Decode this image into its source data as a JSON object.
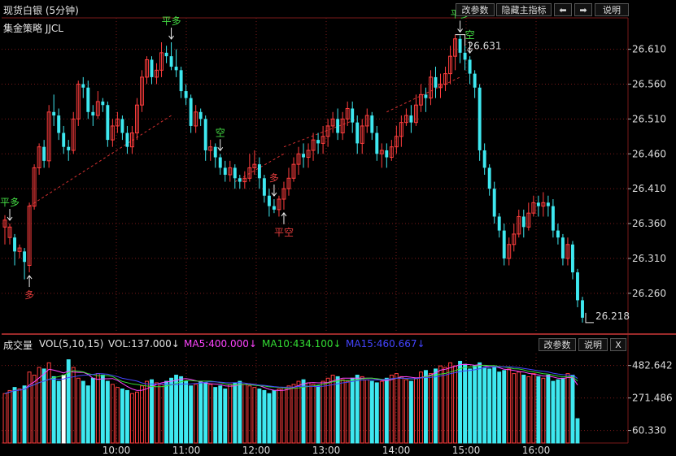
{
  "window": {
    "title": "现货白银 (5分钟)",
    "strategy": "集金策略 JJCL"
  },
  "toolbar": {
    "params_label": "改参数",
    "hide_indicator_label": "隐藏主指标",
    "left_arrow": "⬅",
    "right_arrow": "➡",
    "help_label": "说明"
  },
  "volume_panel": {
    "title": "成交量",
    "vol_params": "VOL(5,10,15)",
    "vol_value": "VOL:137.000↓",
    "ma5": "MA5:400.000↓",
    "ma10": "MA10:434.100↓",
    "ma15": "MA15:460.667↓",
    "params_label": "改参数",
    "help_label": "说明",
    "close_label": "X"
  },
  "colors": {
    "up": "#ff3d3d",
    "down": "#3ee8f0",
    "ma5": "#ff44ff",
    "ma10": "#33dd33",
    "ma15": "#4444ff",
    "grid": "#7a1a1a",
    "buy": "#e23c3c",
    "sell": "#44dd44"
  },
  "chart_data": [
    {
      "type": "candlestick",
      "title": "现货白银 (5分钟)",
      "y_ticks": [
        "26.610",
        "26.560",
        "26.510",
        "26.460",
        "26.410",
        "26.360",
        "26.310",
        "26.260"
      ],
      "ylim": [
        26.205,
        26.655
      ],
      "x_ticks": [
        "10:00",
        "11:00",
        "12:00",
        "13:00",
        "14:00",
        "15:00",
        "16:00"
      ],
      "price_labels": {
        "high": "26.631",
        "low": "26.218"
      },
      "ohlc": [
        [
          26.355,
          26.365,
          26.33,
          26.372
        ],
        [
          26.34,
          26.355,
          26.33,
          26.36
        ],
        [
          26.34,
          26.32,
          26.3,
          26.345
        ],
        [
          26.32,
          26.325,
          26.31,
          26.33
        ],
        [
          26.32,
          26.305,
          26.28,
          26.325
        ],
        [
          26.3,
          26.385,
          26.29,
          26.39
        ],
        [
          26.385,
          26.44,
          26.38,
          26.445
        ],
        [
          26.44,
          26.47,
          26.43,
          26.475
        ],
        [
          26.47,
          26.45,
          26.44,
          26.48
        ],
        [
          26.45,
          26.52,
          26.44,
          26.53
        ],
        [
          26.52,
          26.515,
          26.5,
          26.545
        ],
        [
          26.515,
          26.49,
          26.48,
          26.525
        ],
        [
          26.49,
          26.47,
          26.46,
          26.5
        ],
        [
          26.47,
          26.465,
          26.45,
          26.48
        ],
        [
          26.465,
          26.51,
          26.46,
          26.52
        ],
        [
          26.51,
          26.56,
          26.5,
          26.565
        ],
        [
          26.56,
          26.555,
          26.54,
          26.57
        ],
        [
          26.555,
          26.52,
          26.51,
          26.565
        ],
        [
          26.52,
          26.515,
          26.5,
          26.53
        ],
        [
          26.515,
          26.535,
          26.51,
          26.55
        ],
        [
          26.535,
          26.53,
          26.52,
          26.54
        ],
        [
          26.53,
          26.48,
          26.47,
          26.535
        ],
        [
          26.48,
          26.5,
          26.47,
          26.51
        ],
        [
          26.5,
          26.51,
          26.49,
          26.52
        ],
        [
          26.51,
          26.49,
          26.48,
          26.515
        ],
        [
          26.49,
          26.47,
          26.46,
          26.5
        ],
        [
          26.47,
          26.49,
          26.46,
          26.5
        ],
        [
          26.49,
          26.53,
          26.48,
          26.54
        ],
        [
          26.53,
          26.57,
          26.52,
          26.58
        ],
        [
          26.57,
          26.595,
          26.56,
          26.6
        ],
        [
          26.595,
          26.57,
          26.56,
          26.6
        ],
        [
          26.57,
          26.58,
          26.56,
          26.59
        ],
        [
          26.58,
          26.605,
          26.57,
          26.62
        ],
        [
          26.605,
          26.6,
          26.59,
          26.615
        ],
        [
          26.6,
          26.585,
          26.58,
          26.62
        ],
        [
          26.585,
          26.58,
          26.57,
          26.61
        ],
        [
          26.58,
          26.55,
          26.54,
          26.585
        ],
        [
          26.55,
          26.54,
          26.53,
          26.56
        ],
        [
          26.54,
          26.5,
          26.49,
          26.545
        ],
        [
          26.5,
          26.52,
          26.49,
          26.53
        ],
        [
          26.52,
          26.51,
          26.5,
          26.525
        ],
        [
          26.51,
          26.465,
          26.45,
          26.515
        ],
        [
          26.465,
          26.47,
          26.45,
          26.48
        ],
        [
          26.47,
          26.455,
          26.44,
          26.475
        ],
        [
          26.455,
          26.44,
          26.43,
          26.46
        ],
        [
          26.44,
          26.43,
          26.42,
          26.45
        ],
        [
          26.43,
          26.44,
          26.42,
          26.45
        ],
        [
          26.44,
          26.425,
          26.41,
          26.445
        ],
        [
          26.425,
          26.42,
          26.41,
          26.43
        ],
        [
          26.42,
          26.425,
          26.41,
          26.435
        ],
        [
          26.425,
          26.44,
          26.42,
          26.46
        ],
        [
          26.44,
          26.445,
          26.43,
          26.465
        ],
        [
          26.445,
          26.425,
          26.41,
          26.455
        ],
        [
          26.425,
          26.4,
          26.39,
          26.43
        ],
        [
          26.4,
          26.385,
          26.37,
          26.41
        ],
        [
          26.385,
          26.38,
          26.375,
          26.395
        ],
        [
          26.38,
          26.395,
          26.37,
          26.4
        ],
        [
          26.395,
          26.41,
          26.38,
          26.42
        ],
        [
          26.41,
          26.425,
          26.4,
          26.44
        ],
        [
          26.425,
          26.445,
          26.42,
          26.455
        ],
        [
          26.445,
          26.46,
          26.43,
          26.47
        ],
        [
          26.46,
          26.455,
          26.44,
          26.475
        ],
        [
          26.455,
          26.465,
          26.44,
          26.475
        ],
        [
          26.465,
          26.48,
          26.45,
          26.49
        ],
        [
          26.48,
          26.475,
          26.46,
          26.49
        ],
        [
          26.475,
          26.485,
          26.46,
          26.5
        ],
        [
          26.485,
          26.5,
          26.47,
          26.51
        ],
        [
          26.5,
          26.51,
          26.49,
          26.52
        ],
        [
          26.51,
          26.49,
          26.48,
          26.525
        ],
        [
          26.49,
          26.51,
          26.48,
          26.52
        ],
        [
          26.51,
          26.525,
          26.5,
          26.535
        ],
        [
          26.525,
          26.505,
          26.49,
          26.535
        ],
        [
          26.505,
          26.475,
          26.46,
          26.515
        ],
        [
          26.475,
          26.5,
          26.46,
          26.51
        ],
        [
          26.5,
          26.515,
          26.49,
          26.525
        ],
        [
          26.515,
          26.49,
          26.48,
          26.52
        ],
        [
          26.49,
          26.46,
          26.45,
          26.5
        ],
        [
          26.46,
          26.465,
          26.44,
          26.475
        ],
        [
          26.465,
          26.455,
          26.44,
          26.475
        ],
        [
          26.455,
          26.47,
          26.45,
          26.48
        ],
        [
          26.47,
          26.485,
          26.46,
          26.5
        ],
        [
          26.485,
          26.505,
          26.47,
          26.515
        ],
        [
          26.505,
          26.515,
          26.5,
          26.525
        ],
        [
          26.515,
          26.505,
          26.49,
          26.53
        ],
        [
          26.505,
          26.53,
          26.5,
          26.545
        ],
        [
          26.53,
          26.545,
          26.52,
          26.56
        ],
        [
          26.545,
          26.54,
          26.52,
          26.555
        ],
        [
          26.54,
          26.57,
          26.53,
          26.58
        ],
        [
          26.57,
          26.555,
          26.54,
          26.585
        ],
        [
          26.555,
          26.56,
          26.54,
          26.575
        ],
        [
          26.56,
          26.575,
          26.55,
          26.585
        ],
        [
          26.575,
          26.6,
          26.56,
          26.615
        ],
        [
          26.6,
          26.625,
          26.58,
          26.631
        ],
        [
          26.625,
          26.605,
          26.59,
          26.63
        ],
        [
          26.605,
          26.595,
          26.58,
          26.615
        ],
        [
          26.595,
          26.575,
          26.56,
          26.6
        ],
        [
          26.575,
          26.555,
          26.54,
          26.58
        ],
        [
          26.555,
          26.465,
          26.45,
          26.56
        ],
        [
          26.465,
          26.44,
          26.43,
          26.475
        ],
        [
          26.44,
          26.41,
          26.4,
          26.445
        ],
        [
          26.41,
          26.37,
          26.36,
          26.42
        ],
        [
          26.37,
          26.35,
          26.34,
          26.375
        ],
        [
          26.35,
          26.31,
          26.3,
          26.36
        ],
        [
          26.31,
          26.33,
          26.3,
          26.34
        ],
        [
          26.33,
          26.345,
          26.32,
          26.36
        ],
        [
          26.345,
          26.37,
          26.34,
          26.38
        ],
        [
          26.37,
          26.355,
          26.34,
          26.38
        ],
        [
          26.355,
          26.375,
          26.35,
          26.39
        ],
        [
          26.375,
          26.39,
          26.37,
          26.4
        ],
        [
          26.39,
          26.385,
          26.37,
          26.4
        ],
        [
          26.385,
          26.39,
          26.37,
          26.405
        ],
        [
          26.39,
          26.385,
          26.37,
          26.4
        ],
        [
          26.385,
          26.35,
          26.34,
          26.395
        ],
        [
          26.35,
          26.34,
          26.33,
          26.36
        ],
        [
          26.34,
          26.31,
          26.3,
          26.345
        ],
        [
          26.31,
          26.33,
          26.3,
          26.34
        ],
        [
          26.33,
          26.29,
          26.28,
          26.335
        ],
        [
          26.29,
          26.25,
          26.24,
          26.295
        ],
        [
          26.25,
          26.225,
          26.218,
          26.255
        ]
      ],
      "signals": [
        {
          "index": 1,
          "text": "平多",
          "kind": "sell",
          "pos": "above"
        },
        {
          "index": 5,
          "text": "多",
          "kind": "buy",
          "pos": "below"
        },
        {
          "index": 34,
          "text": "平多",
          "kind": "sell",
          "pos": "above"
        },
        {
          "index": 44,
          "text": "空",
          "kind": "sell",
          "pos": "above"
        },
        {
          "index": 55,
          "text": "多",
          "kind": "buy",
          "pos": "above"
        },
        {
          "index": 57,
          "text": "平空",
          "kind": "buy",
          "pos": "below"
        },
        {
          "index": 93,
          "text": "平多",
          "kind": "sell",
          "pos": "above"
        },
        {
          "index": 95,
          "text": "空",
          "kind": "sell",
          "pos": "above"
        }
      ],
      "trend_lines": [
        {
          "from": 5,
          "from_price": 26.385,
          "to": 34,
          "to_price": 26.515
        },
        {
          "from": 47,
          "from_price": 26.42,
          "to": 57,
          "to_price": 26.46
        },
        {
          "from": 57,
          "from_price": 26.47,
          "to": 72,
          "to_price": 26.51
        },
        {
          "from": 78,
          "from_price": 26.52,
          "to": 93,
          "to_price": 26.57
        }
      ]
    },
    {
      "type": "bar",
      "title": "成交量",
      "y_ticks": [
        "482.642",
        "271.486",
        "60.330"
      ],
      "ylim": [
        0,
        560
      ],
      "x_ticks": [
        "10:00",
        "11:00",
        "12:00",
        "13:00",
        "14:00",
        "15:00",
        "16:00"
      ],
      "values": [
        300,
        320,
        340,
        330,
        350,
        440,
        420,
        470,
        460,
        500,
        410,
        380,
        420,
        520,
        470,
        400,
        380,
        350,
        400,
        430,
        420,
        380,
        360,
        340,
        330,
        320,
        300,
        310,
        350,
        380,
        390,
        370,
        360,
        380,
        400,
        420,
        410,
        380,
        350,
        360,
        380,
        370,
        360,
        340,
        350,
        330,
        360,
        370,
        380,
        360,
        350,
        340,
        330,
        320,
        300,
        320,
        330,
        340,
        350,
        360,
        380,
        390,
        370,
        360,
        350,
        380,
        400,
        420,
        410,
        390,
        380,
        400,
        420,
        410,
        390,
        380,
        370,
        380,
        400,
        420,
        430,
        410,
        390,
        380,
        400,
        440,
        450,
        430,
        460,
        480,
        470,
        500,
        480,
        510,
        490,
        460,
        480,
        500,
        470,
        460,
        470,
        440,
        450,
        460,
        430,
        440,
        420,
        410,
        430,
        410,
        400,
        420,
        380,
        390,
        400,
        430,
        420,
        137
      ],
      "ma5_label": "MA5:400.000↓",
      "ma10_label": "MA10:434.100↓",
      "ma15_label": "MA15:460.667↓"
    }
  ]
}
